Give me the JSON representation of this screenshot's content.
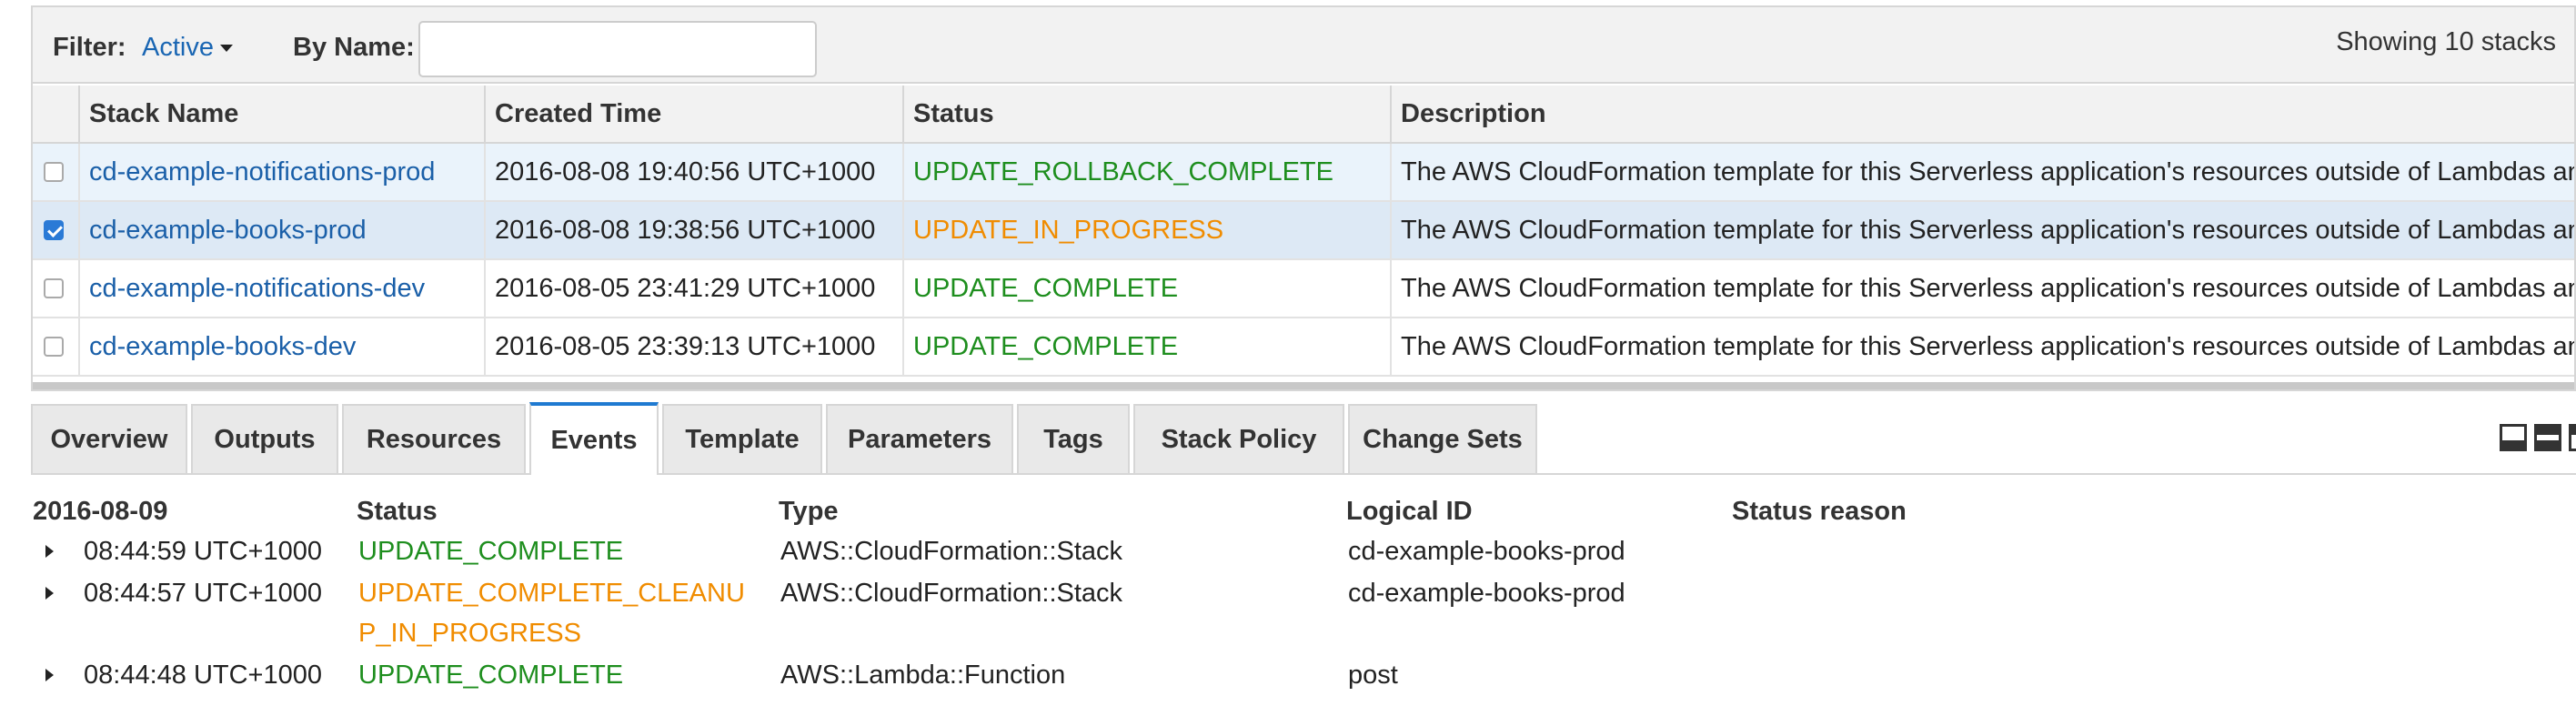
{
  "filter": {
    "label": "Filter:",
    "value": "Active",
    "by_name_label": "By Name:",
    "by_name_value": "",
    "showing": "Showing 10 stacks"
  },
  "stacks_table": {
    "columns": [
      "Stack Name",
      "Created Time",
      "Status",
      "Description"
    ],
    "rows": [
      {
        "name": "cd-example-notifications-prod",
        "created": "2016-08-08 19:40:56 UTC+1000",
        "status": "UPDATE_ROLLBACK_COMPLETE",
        "status_color": "green",
        "description": "The AWS CloudFormation template for this Serverless application's resources outside of Lambdas and A",
        "checked": false
      },
      {
        "name": "cd-example-books-prod",
        "created": "2016-08-08 19:38:56 UTC+1000",
        "status": "UPDATE_IN_PROGRESS",
        "status_color": "orange",
        "description": "The AWS CloudFormation template for this Serverless application's resources outside of Lambdas and A",
        "checked": true
      },
      {
        "name": "cd-example-notifications-dev",
        "created": "2016-08-05 23:41:29 UTC+1000",
        "status": "UPDATE_COMPLETE",
        "status_color": "green",
        "description": "The AWS CloudFormation template for this Serverless application's resources outside of Lambdas and A",
        "checked": false
      },
      {
        "name": "cd-example-books-dev",
        "created": "2016-08-05 23:39:13 UTC+1000",
        "status": "UPDATE_COMPLETE",
        "status_color": "green",
        "description": "The AWS CloudFormation template for this Serverless application's resources outside of Lambdas and A",
        "checked": false
      }
    ]
  },
  "tabs": [
    "Overview",
    "Outputs",
    "Resources",
    "Events",
    "Template",
    "Parameters",
    "Tags",
    "Stack Policy",
    "Change Sets"
  ],
  "active_tab": "Events",
  "layout_icons": [
    "panel-bottom-icon",
    "panel-split-icon",
    "panel-top-icon"
  ],
  "events": {
    "date_header": "2016-08-09",
    "columns": [
      "Status",
      "Type",
      "Logical ID",
      "Status reason"
    ],
    "rows": [
      {
        "time": "08:44:59 UTC+1000",
        "status": "UPDATE_COMPLETE",
        "status_color": "green",
        "type": "AWS::CloudFormation::Stack",
        "logical_id": "cd-example-books-prod",
        "reason": ""
      },
      {
        "time": "08:44:57 UTC+1000",
        "status": "UPDATE_COMPLETE_CLEANUP_IN_PROGRESS",
        "status_color": "orange",
        "type": "AWS::CloudFormation::Stack",
        "logical_id": "cd-example-books-prod",
        "reason": ""
      },
      {
        "time": "08:44:48 UTC+1000",
        "status": "UPDATE_COMPLETE",
        "status_color": "green",
        "type": "AWS::Lambda::Function",
        "logical_id": "post",
        "reason": ""
      }
    ]
  },
  "colors": {
    "link_blue": "#1a5fa8",
    "status_green": "#1e8e1e",
    "status_orange": "#f08c00",
    "active_tab_accent": "#1f7ad1"
  }
}
